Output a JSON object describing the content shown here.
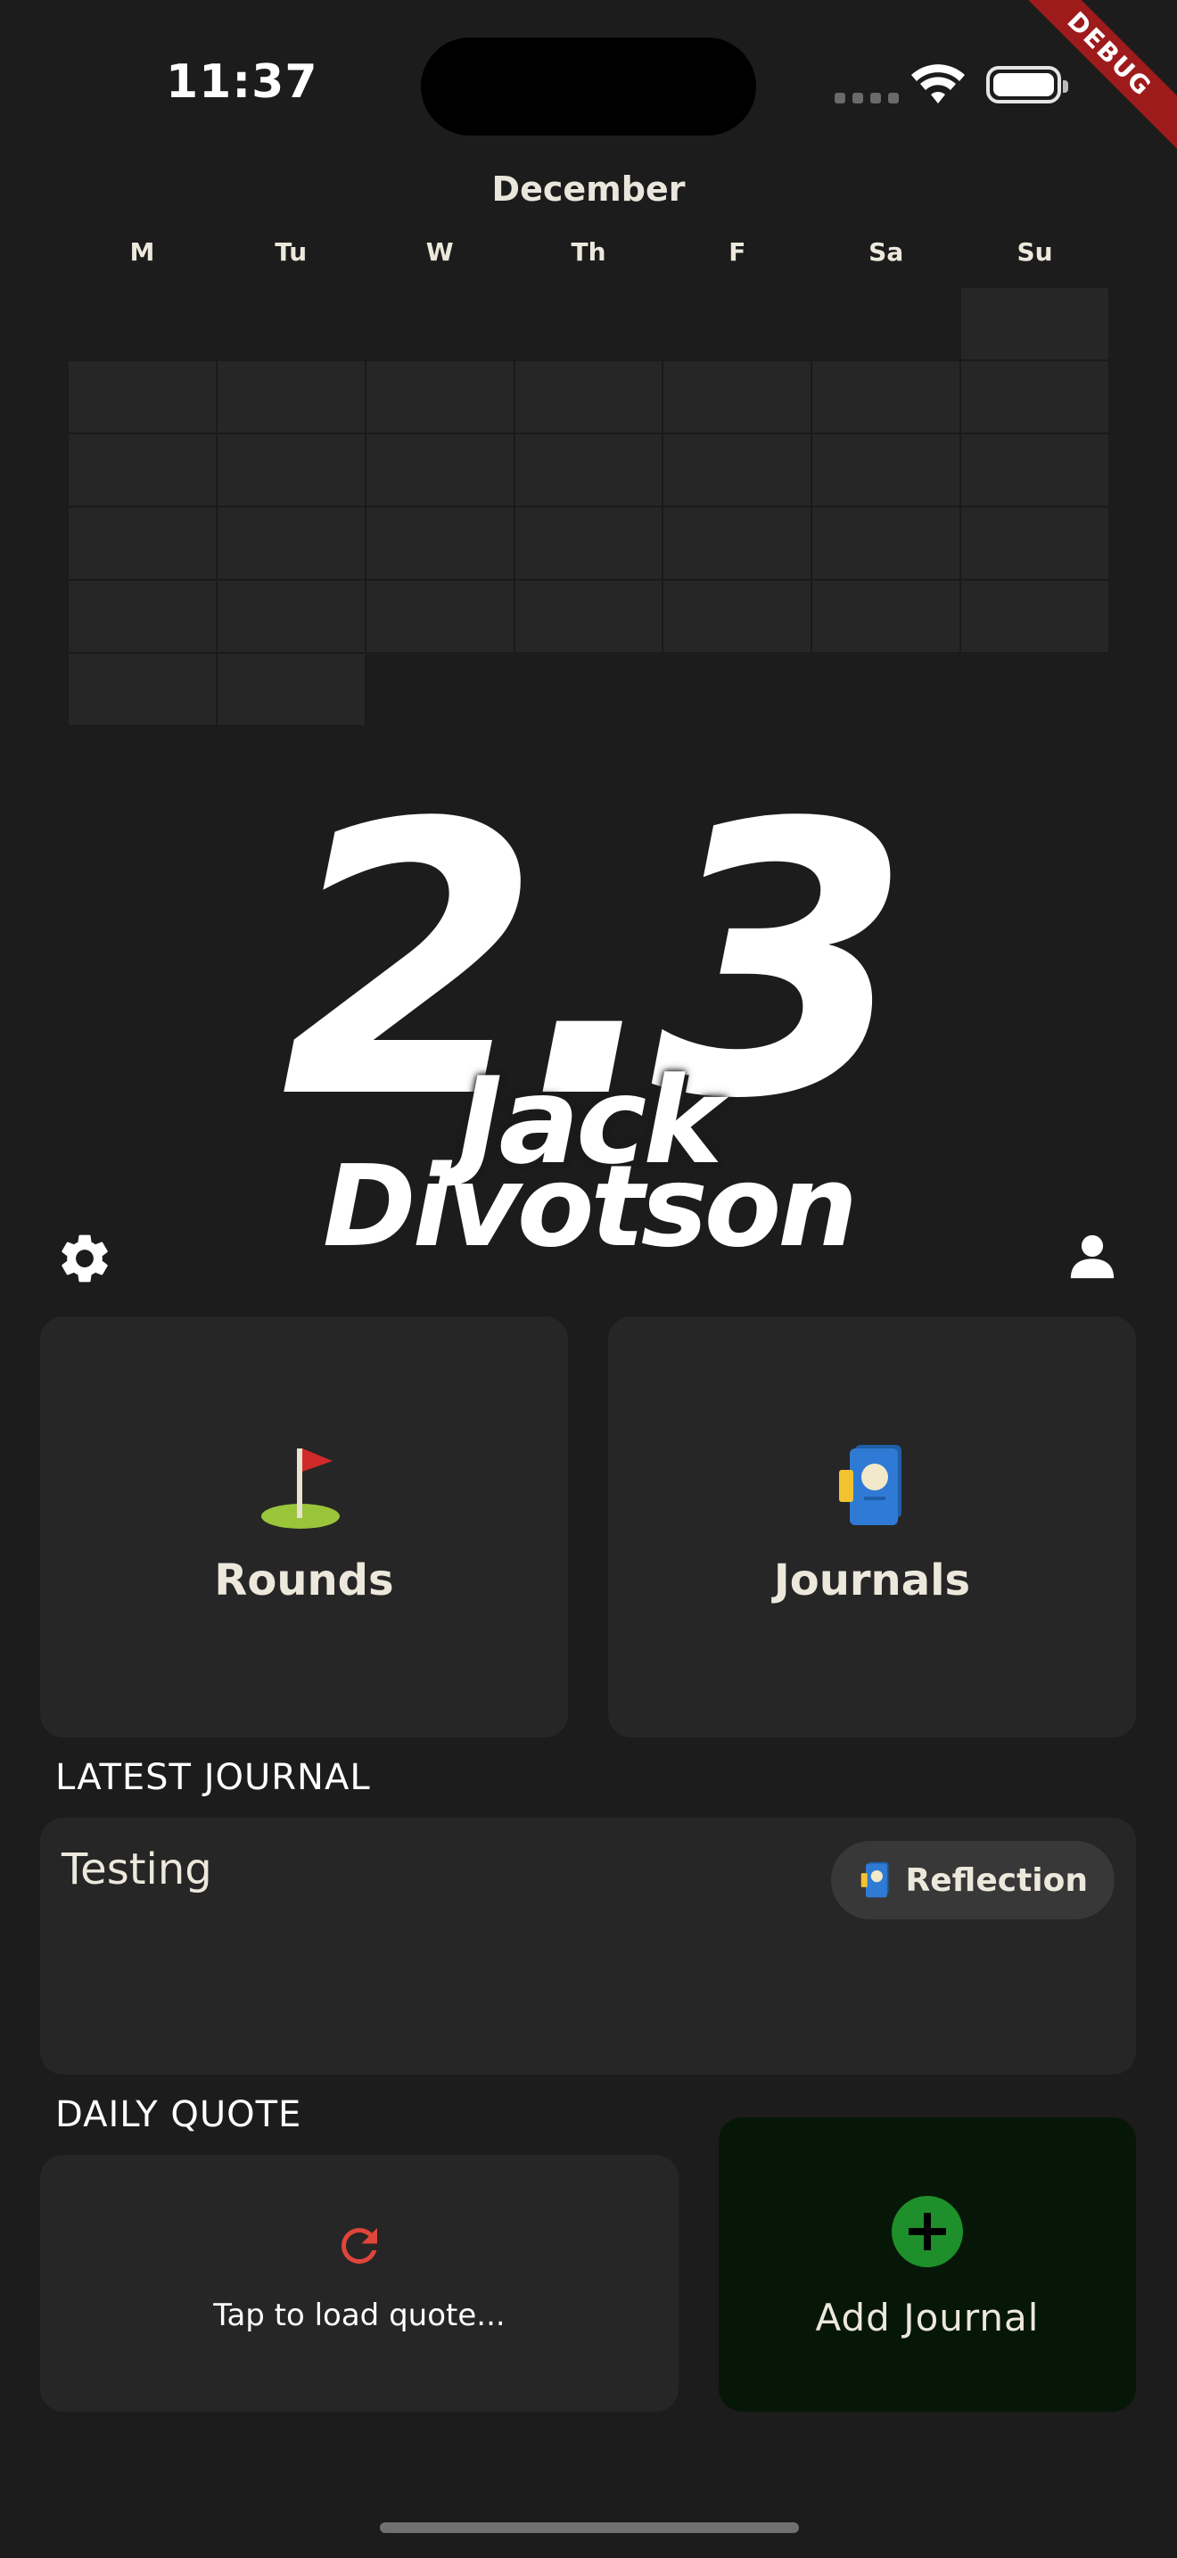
{
  "status_bar": {
    "time": "11:37"
  },
  "debug_banner": "DEBUG",
  "calendar": {
    "month": "December",
    "weekdays": [
      "M",
      "Tu",
      "W",
      "Th",
      "F",
      "Sa",
      "Su"
    ]
  },
  "profile": {
    "handicap": "2.3",
    "first_name": "Jack",
    "last_name": "Divotson"
  },
  "toolbar": {
    "settings_icon": "gear-icon",
    "profile_icon": "person-icon"
  },
  "tiles": {
    "rounds": {
      "label": "Rounds",
      "icon": "golf-flag-icon"
    },
    "journals": {
      "label": "Journals",
      "icon": "journal-book-icon"
    }
  },
  "latest_journal": {
    "section_title": "LATEST JOURNAL",
    "title": "Testing",
    "tag": "Reflection"
  },
  "daily_quote": {
    "section_title": "DAILY QUOTE",
    "text": "Tap to load quote..."
  },
  "add_journal": {
    "label": "Add Journal"
  },
  "colors": {
    "background": "#1c1c1c",
    "card": "#262626",
    "add_journal_bg": "#071707",
    "add_icon": "#1e8f2b",
    "refresh_icon": "#e0453a",
    "debug": "#9e1b1b"
  }
}
